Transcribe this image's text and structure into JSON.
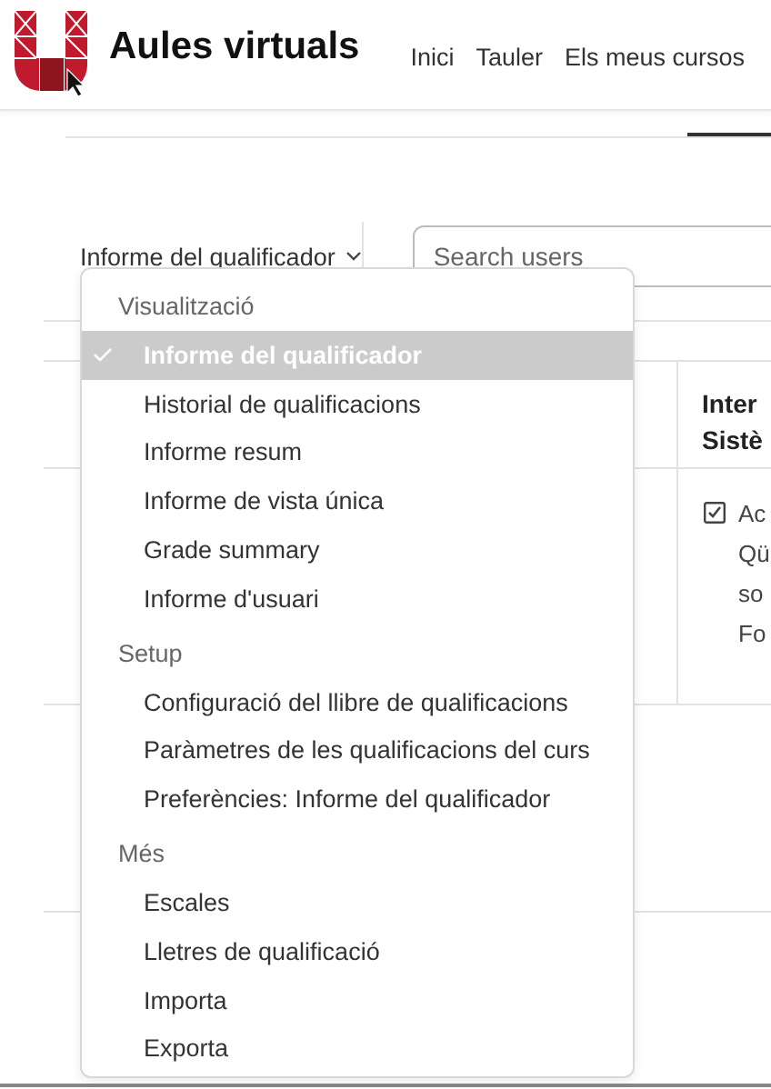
{
  "header": {
    "title": "Aules virtuals",
    "nav": [
      "Inici",
      "Tauler",
      "Els meus cursos"
    ]
  },
  "report_selector": {
    "label": "Informe del qualificador",
    "expanded": true
  },
  "search": {
    "placeholder": "Search users"
  },
  "table": {
    "header_cell": {
      "lines": [
        "Inter",
        "Sistè"
      ]
    },
    "body_cell": {
      "checked": true,
      "lines": [
        "Ac",
        "Qü",
        "so",
        "Fo"
      ]
    }
  },
  "menu": {
    "sections": [
      {
        "title": "Visualització",
        "items": [
          {
            "label": "Informe del qualificador",
            "selected": true
          },
          {
            "label": "Historial de qualificacions",
            "selected": false
          },
          {
            "label": "Informe resum",
            "selected": false
          },
          {
            "label": "Informe de vista única",
            "selected": false
          },
          {
            "label": "Grade summary",
            "selected": false
          },
          {
            "label": "Informe d'usuari",
            "selected": false
          }
        ]
      },
      {
        "title": "Setup",
        "items": [
          {
            "label": "Configuració del llibre de qualificacions",
            "selected": false
          },
          {
            "label": "Paràmetres de les qualificacions del curs",
            "selected": false
          },
          {
            "label": "Preferències: Informe del qualificador",
            "selected": false
          }
        ]
      },
      {
        "title": "Més",
        "items": [
          {
            "label": "Escales",
            "selected": false
          },
          {
            "label": "Lletres de qualificació",
            "selected": false
          },
          {
            "label": "Importa",
            "selected": false
          },
          {
            "label": "Exporta",
            "selected": false
          }
        ]
      }
    ]
  }
}
